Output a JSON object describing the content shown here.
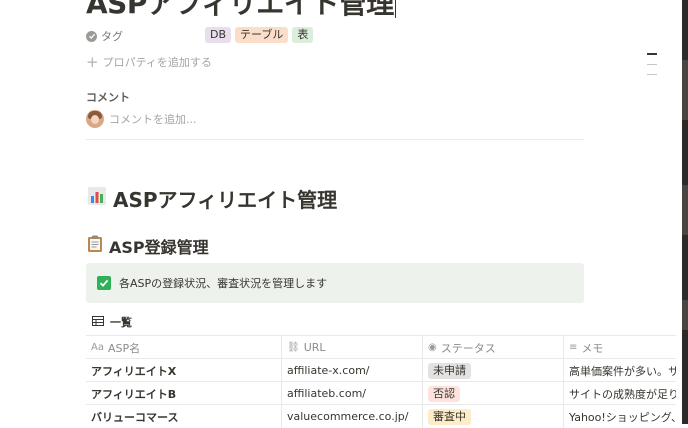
{
  "page": {
    "title": "ASPアフィリエイト管理"
  },
  "properties": {
    "tags_label": "タグ",
    "tags": [
      {
        "label": "DB",
        "color": "#e8deee"
      },
      {
        "label": "テーブル",
        "color": "#fadec9"
      },
      {
        "label": "表",
        "color": "#dbeddb"
      }
    ],
    "add_property": "プロパティを追加する"
  },
  "comments": {
    "label": "コメント",
    "placeholder": "コメントを追加..."
  },
  "content": {
    "heading1": "ASPアフィリエイト管理",
    "heading2": "ASP登録管理",
    "callout": "各ASPの登録状況、審査状況を管理します"
  },
  "table": {
    "view_name": "一覧",
    "columns": [
      {
        "label": "ASP名",
        "icon": "title-icon"
      },
      {
        "label": "URL",
        "icon": "link-icon"
      },
      {
        "label": "ステータス",
        "icon": "status-icon"
      },
      {
        "label": "メモ",
        "icon": "text-icon"
      }
    ],
    "rows": [
      {
        "name": "アフィリエイトX",
        "url": "affiliate-x.com/",
        "status": "未申請",
        "status_color": "#e3e2e0",
        "memo": "高単価案件が多い。サ"
      },
      {
        "name": "アフィリエイトB",
        "url": "affiliateb.com/",
        "status": "否認",
        "status_color": "#ffe2dd",
        "memo": "サイトの成熟度が足り"
      },
      {
        "name": "バリューコマース",
        "url": "valuecommerce.co.jp/",
        "status": "審査中",
        "status_color": "#fdecc8",
        "memo": "Yahoo!ショッピング、"
      }
    ]
  }
}
